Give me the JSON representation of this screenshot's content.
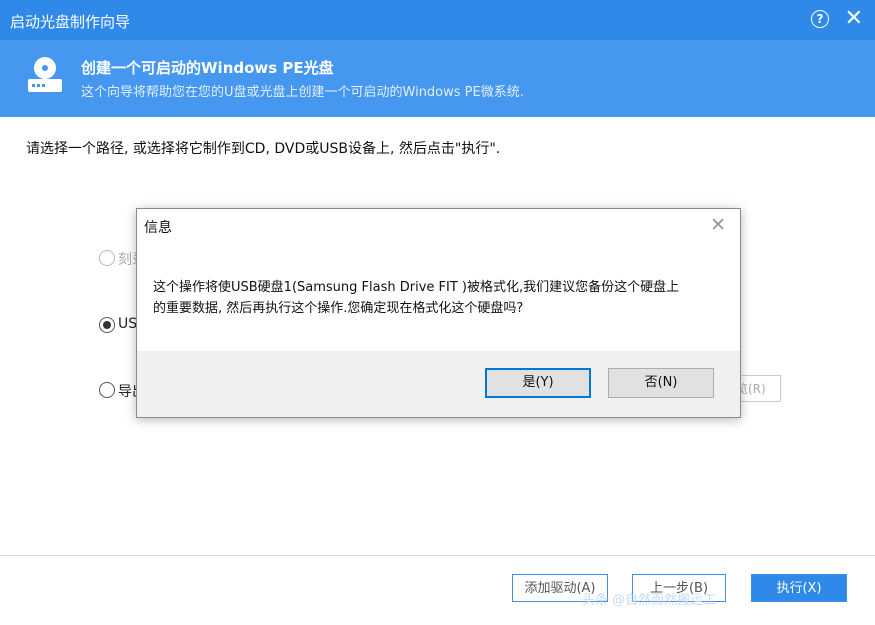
{
  "window": {
    "title": "启动光盘制作向导"
  },
  "banner": {
    "heading": "创建一个可启动的Windows PE光盘",
    "subheading": "这个向导将帮助您在您的U盘或光盘上创建一个可启动的Windows PE微系统."
  },
  "instruction": "请选择一个路径, 或选择将它制作到CD, DVD或USB设备上, 然后点击\"执行\".",
  "options": [
    {
      "label": "刻录",
      "state": "disabled"
    },
    {
      "label": "USB",
      "state": "checked"
    },
    {
      "label": "导出",
      "state": "unchecked"
    }
  ],
  "browse_stub": "览(R)",
  "footer": {
    "add_driver": "添加驱动(A)",
    "prev": "上一步(B)",
    "execute": "执行(X)"
  },
  "watermark": "头条 @自然而然搬运工",
  "dialog": {
    "title": "信息",
    "message_line1": "这个操作将使USB硬盘1(Samsung Flash Drive FIT )被格式化,我们建议您备份这个硬盘上",
    "message_line2": "的重要数据, 然后再执行这个操作.您确定现在格式化这个硬盘吗?",
    "yes": "是(Y)",
    "no": "否(N)"
  },
  "colors": {
    "titlebar": "#2f89e8",
    "banner": "#4597ef",
    "accent": "#0078d7"
  }
}
